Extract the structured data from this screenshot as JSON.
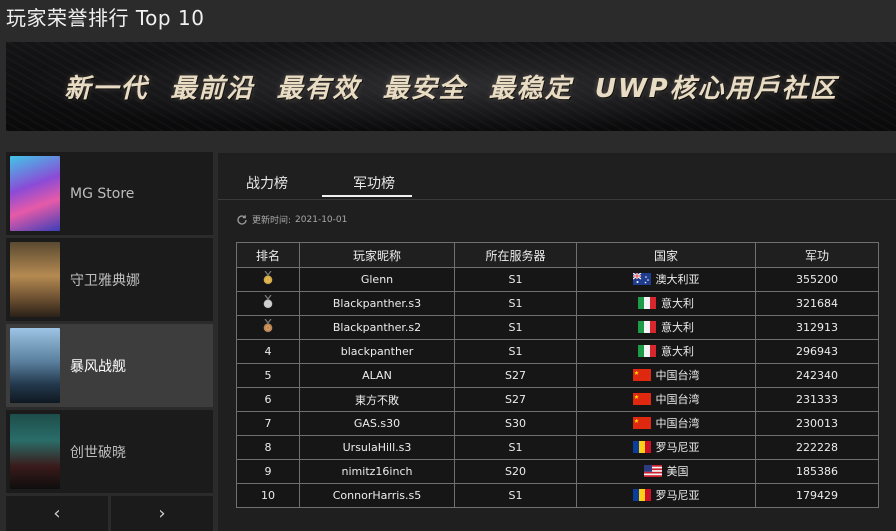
{
  "page": {
    "title": "玩家荣誉排行 Top 10"
  },
  "banner": {
    "text": "新一代  最前沿  最有效  最安全  最稳定  UWP核心用戶社区"
  },
  "sidebar": {
    "games": [
      {
        "label": "MG Store",
        "active": false
      },
      {
        "label": "守卫雅典娜",
        "active": false
      },
      {
        "label": "暴风战舰",
        "active": true
      },
      {
        "label": "创世破晓",
        "active": false
      }
    ],
    "prev_icon": "chevron-left-icon",
    "next_icon": "chevron-right-icon",
    "prev_label": "‹",
    "next_label": "›"
  },
  "tabs": [
    {
      "label": "战力榜",
      "active": false
    },
    {
      "label": "军功榜",
      "active": true
    }
  ],
  "update": {
    "label": "更新时间:",
    "date": "2021-10-01"
  },
  "table": {
    "headers": [
      "排名",
      "玩家昵称",
      "所在服务器",
      "国家",
      "军功"
    ],
    "rows": [
      {
        "rank": "",
        "medal": "gold",
        "name": "Glenn",
        "server": "S1",
        "country": "澳大利亚",
        "flag": "au",
        "score": "355200"
      },
      {
        "rank": "",
        "medal": "silver",
        "name": "Blackpanther.s3",
        "server": "S1",
        "country": "意大利",
        "flag": "it",
        "score": "321684"
      },
      {
        "rank": "",
        "medal": "bronze",
        "name": "Blackpanther.s2",
        "server": "S1",
        "country": "意大利",
        "flag": "it",
        "score": "312913"
      },
      {
        "rank": "4",
        "medal": "",
        "name": "blackpanther",
        "server": "S1",
        "country": "意大利",
        "flag": "it",
        "score": "296943"
      },
      {
        "rank": "5",
        "medal": "",
        "name": "ALAN",
        "server": "S27",
        "country": "中国台湾",
        "flag": "cn",
        "score": "242340"
      },
      {
        "rank": "6",
        "medal": "",
        "name": "東方不敗",
        "server": "S27",
        "country": "中国台湾",
        "flag": "cn",
        "score": "231333"
      },
      {
        "rank": "7",
        "medal": "",
        "name": "GAS.s30",
        "server": "S30",
        "country": "中国台湾",
        "flag": "cn",
        "score": "230013"
      },
      {
        "rank": "8",
        "medal": "",
        "name": "UrsulaHill.s3",
        "server": "S1",
        "country": "罗马尼亚",
        "flag": "ro",
        "score": "222228"
      },
      {
        "rank": "9",
        "medal": "",
        "name": "nimitz16inch",
        "server": "S20",
        "country": "美国",
        "flag": "us",
        "score": "185386"
      },
      {
        "rank": "10",
        "medal": "",
        "name": "ConnorHarris.s5",
        "server": "S1",
        "country": "罗马尼亚",
        "flag": "ro",
        "score": "179429"
      }
    ]
  },
  "colors": {
    "gold": "#d9a93a",
    "silver": "#c9c9c9",
    "bronze": "#c0834a",
    "active_tab_underline": "#f0f0f0",
    "selected_game_bg": "#3d3d3d"
  }
}
